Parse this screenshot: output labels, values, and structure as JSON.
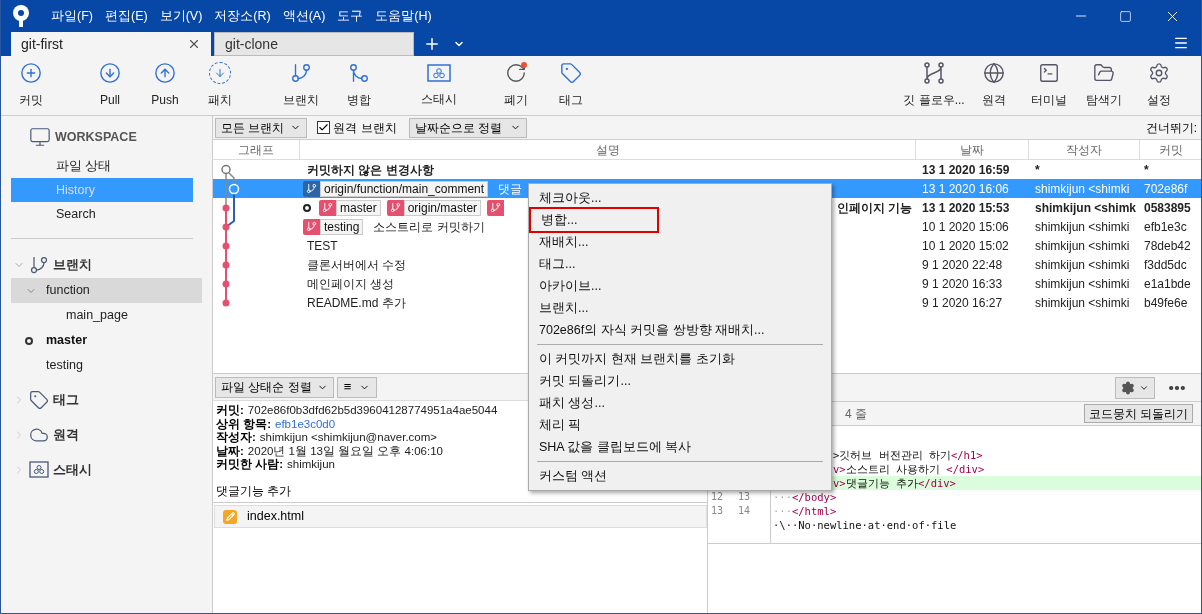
{
  "window": {
    "menu": [
      "파일(F)",
      "편집(E)",
      "보기(V)",
      "저장소(R)",
      "액션(A)",
      "도구",
      "도움말(H)"
    ]
  },
  "tabs": [
    {
      "label": "git-first",
      "selected": true
    },
    {
      "label": "git-clone",
      "selected": false
    }
  ],
  "toolbar": {
    "left": [
      {
        "label": "커밋"
      },
      {
        "label": "Pull"
      },
      {
        "label": "Push"
      },
      {
        "label": "패치"
      },
      {
        "label": "브랜치"
      },
      {
        "label": "병합"
      },
      {
        "label": "스태시"
      },
      {
        "label": "폐기"
      },
      {
        "label": "태그"
      }
    ],
    "right": [
      {
        "label": "깃 플로우..."
      },
      {
        "label": "원격"
      },
      {
        "label": "터미널"
      },
      {
        "label": "탐색기"
      },
      {
        "label": "설정"
      }
    ]
  },
  "sidebar": {
    "workspace": {
      "title": "WORKSPACE",
      "items": [
        {
          "label": "파일 상태",
          "selected": false
        },
        {
          "label": "History",
          "selected": true
        },
        {
          "label": "Search",
          "selected": false
        }
      ]
    },
    "sections": [
      {
        "label": "브랜치",
        "kind": "branch",
        "expanded": true,
        "items": [
          {
            "label": "function",
            "selected": true,
            "current": false,
            "expanded": true,
            "children": [
              {
                "label": "main_page",
                "selected": false,
                "current": false
              }
            ]
          },
          {
            "label": "master",
            "selected": false,
            "current": true
          },
          {
            "label": "testing",
            "selected": false,
            "current": false
          }
        ]
      },
      {
        "label": "태그",
        "kind": "tag",
        "expanded": false
      },
      {
        "label": "원격",
        "kind": "remote",
        "expanded": false
      },
      {
        "label": "스태시",
        "kind": "stash",
        "expanded": false
      }
    ]
  },
  "filter_bar": {
    "branches": "모든 브랜치",
    "remote_branches": {
      "label": "원격 브랜치",
      "checked": true
    },
    "sort": "날짜순으로 정렬",
    "jump": "건너뛰기:"
  },
  "table": {
    "columns": [
      "그래프",
      "설명",
      "날짜",
      "작성자",
      "커밋"
    ],
    "rows": [
      {
        "selected": false,
        "bold": true,
        "tags": [],
        "description": "커밋하지 않은 변경사항",
        "date": "13 1 2020 16:59",
        "author": "*",
        "commit": "*"
      },
      {
        "selected": true,
        "bold": false,
        "tags": [
          {
            "kind": "branch",
            "label": "origin/function/main_comment"
          }
        ],
        "description": "댓글",
        "date": "13 1 2020 16:06",
        "author": "shimkijun <shimki",
        "commit": "702e86f"
      },
      {
        "selected": false,
        "bold": true,
        "head": true,
        "tags": [
          {
            "kind": "branch",
            "label": "master"
          },
          {
            "kind": "branch",
            "label": "origin/master"
          },
          {
            "kind": "branch"
          }
        ],
        "description": "인페이지 기능",
        "description_cut": true,
        "date": "13 1 2020 15:53",
        "author": "shimkijun <shimk",
        "commit": "0583895"
      },
      {
        "selected": false,
        "bold": false,
        "tags": [
          {
            "kind": "branch",
            "label": "testing"
          }
        ],
        "description": "소스트리로 커밋하기",
        "date": "10 1 2020 15:06",
        "author": "shimkijun <shimki",
        "commit": "efb1e3c"
      },
      {
        "selected": false,
        "bold": false,
        "tags": [],
        "description": "TEST",
        "date": "10 1 2020 15:02",
        "author": "shimkijun <shimki",
        "commit": "78deb42"
      },
      {
        "selected": false,
        "bold": false,
        "tags": [],
        "description": "클론서버에서 수정",
        "date": "9 1 2020 22:48",
        "author": "shimkijun <shimki",
        "commit": "f3dd5dc"
      },
      {
        "selected": false,
        "bold": false,
        "tags": [],
        "description": "메인페이지 생성",
        "date": "9 1 2020 16:33",
        "author": "shimkijun <shimki",
        "commit": "e1a1bde"
      },
      {
        "selected": false,
        "bold": false,
        "tags": [],
        "description": "README.md 추가",
        "date": "9 1 2020 16:27",
        "author": "shimkijun <shimki",
        "commit": "b49fe6e"
      }
    ]
  },
  "details": {
    "sort": "파일 상태순 정렬",
    "view_icon": "≡",
    "fields": [
      {
        "label": "커밋:",
        "value": "702e86f0b3dfd62b5d39604128774951a4ae5044",
        "link": false
      },
      {
        "label": "상위 항목:",
        "value": "efb1e3c0d0",
        "link": true
      },
      {
        "label": "작성자:",
        "value": "shimkijun <shimkijun@naver.com>",
        "link": false
      },
      {
        "label": "날짜:",
        "value": "2020년 1월 13일 월요일 오후 4:06:10",
        "link": false
      },
      {
        "label": "커밋한 사람:",
        "value": "shimkijun",
        "link": false
      }
    ],
    "message": "댓글기능 추가",
    "files": [
      {
        "name": "index.html",
        "kind": "modified"
      }
    ]
  },
  "diff": {
    "hunk": "4 줄",
    "revert": "코드뭉치 되돌리기",
    "lines": [
      {
        "cut": true,
        "kind": "context",
        "parts": [
          {
            "t": ">깃허브 버전관리 하기",
            "kind": "text"
          },
          {
            "t": "</h1>",
            "kind": "tag"
          }
        ]
      },
      {
        "cut": true,
        "kind": "context",
        "parts": [
          {
            "t": "v>",
            "kind": "tag"
          },
          {
            "t": "소스트리 사용하기 ",
            "kind": "text"
          },
          {
            "t": "</div>",
            "kind": "tag"
          }
        ]
      },
      {
        "cut": true,
        "kind": "added",
        "parts": [
          {
            "t": "v>",
            "kind": "tag"
          },
          {
            "t": "댓글기능 추가",
            "kind": "text"
          },
          {
            "t": "</div>",
            "kind": "tag"
          }
        ]
      },
      {
        "cut": false,
        "kind": "context",
        "old": "12",
        "new": "13",
        "parts": [
          {
            "t": "···",
            "kind": "ws"
          },
          {
            "t": "</body>",
            "kind": "tag"
          }
        ]
      },
      {
        "cut": false,
        "kind": "context",
        "old": "13",
        "new": "14",
        "parts": [
          {
            "t": "···",
            "kind": "ws"
          },
          {
            "t": "</html>",
            "kind": "tag"
          }
        ]
      },
      {
        "cut": false,
        "kind": "context",
        "parts": [
          {
            "t": "·\\··No·newline·at·end·of·file",
            "kind": "text"
          }
        ]
      }
    ]
  },
  "context_menu": {
    "groups": [
      [
        {
          "label": "체크아웃...",
          "highlighted": false
        },
        {
          "label": "병합...",
          "highlighted": true
        },
        {
          "label": "재배치...",
          "highlighted": false
        },
        {
          "label": "태그...",
          "highlighted": false
        },
        {
          "label": "아카이브...",
          "highlighted": false
        },
        {
          "label": "브랜치...",
          "highlighted": false
        },
        {
          "label": "702e86f의 자식 커밋을 쌍방향 재배치...",
          "highlighted": false
        }
      ],
      [
        {
          "label": "이 커밋까지 현재 브랜치를 초기화",
          "highlighted": false
        },
        {
          "label": "커밋 되돌리기...",
          "highlighted": false
        },
        {
          "label": "패치 생성...",
          "highlighted": false
        },
        {
          "label": "체리 픽",
          "highlighted": false
        },
        {
          "label": "SHA 값을 클립보드에 복사",
          "highlighted": false
        }
      ],
      [
        {
          "label": "커스텀 액션",
          "highlighted": false
        }
      ]
    ]
  }
}
